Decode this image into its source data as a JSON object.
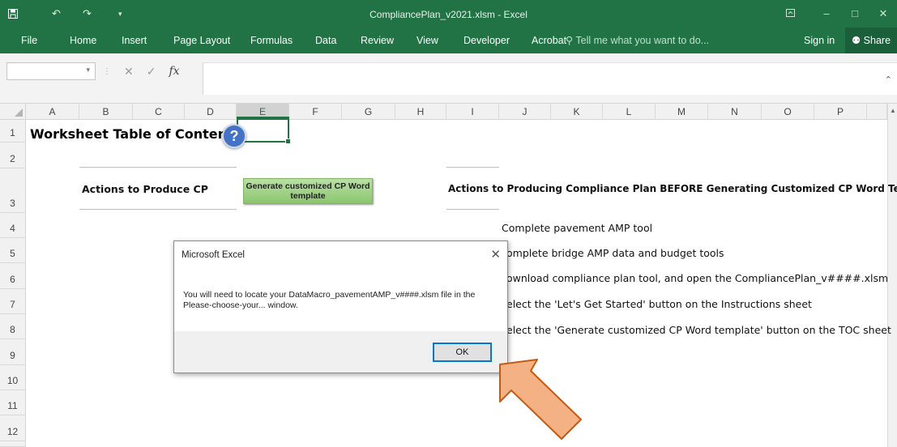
{
  "window": {
    "title": "CompliancePlan_v2021.xlsm - Excel"
  },
  "ribbon": {
    "tabs": [
      "File",
      "Home",
      "Insert",
      "Page Layout",
      "Formulas",
      "Data",
      "Review",
      "View",
      "Developer",
      "Acrobat"
    ],
    "tell_me": "Tell me what you want to do...",
    "sign_in": "Sign in",
    "share": "Share"
  },
  "formula_bar": {
    "name_box": "",
    "fx_label": "fx",
    "content": ""
  },
  "columns": [
    "A",
    "B",
    "C",
    "D",
    "E",
    "F",
    "G",
    "H",
    "I",
    "J",
    "K",
    "L",
    "M",
    "N",
    "O",
    "P"
  ],
  "selected_column": "E",
  "rows": [
    "1",
    "2",
    "3",
    "4",
    "5",
    "6",
    "7",
    "8",
    "9",
    "10",
    "11",
    "12"
  ],
  "sheet": {
    "title": "Worksheet Table of Contents",
    "help_symbol": "?",
    "actions_label": "Actions to Produce CP",
    "generate_button": "Generate customized CP Word template",
    "before_label": "Actions to Producing Compliance Plan BEFORE Generating Customized CP Word Template",
    "steps": [
      "Complete pavement AMP tool",
      "omplete bridge AMP data and budget tools",
      "ownload compliance plan tool, and open the CompliancePlan_v####.xlsm workbo",
      "elect the 'Let's Get Started' button on the Instructions sheet",
      "elect the 'Generate customized CP Word template' button on the TOC sheet"
    ]
  },
  "dialog": {
    "title": "Microsoft Excel",
    "message": "You will need to locate your DataMacro_pavementAMP_v####.xlsm file in the Please-choose-your... window.",
    "ok": "OK"
  },
  "colors": {
    "excel_green": "#217346",
    "help_blue": "#4472c4",
    "button_green": "#a9d18e",
    "arrow_orange": "#f4b183",
    "arrow_outline": "#c55a11"
  }
}
